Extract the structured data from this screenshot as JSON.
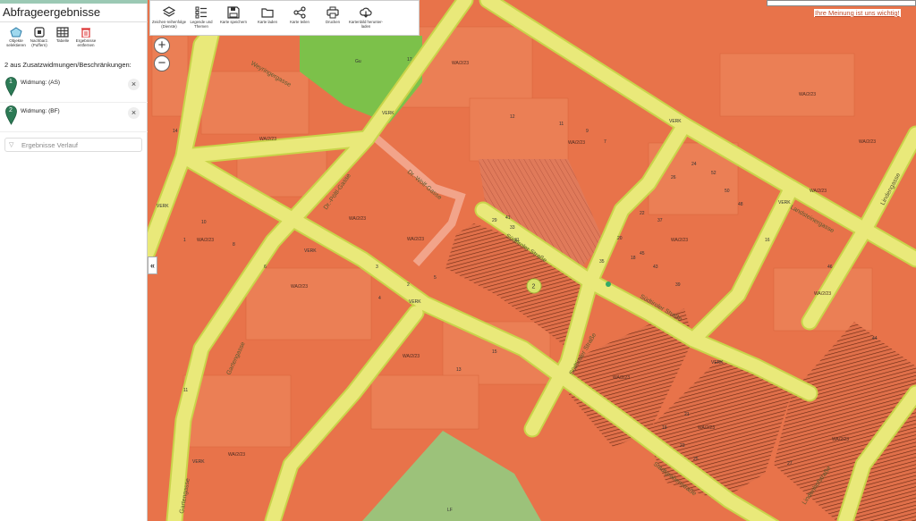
{
  "panel": {
    "title": "Abfrageergebnisse",
    "tools": [
      {
        "icon": "select-objects-icon",
        "label": "Objekte selektieren"
      },
      {
        "icon": "neighbour-search-icon",
        "label": "Nachbarz. (Puffern)"
      },
      {
        "icon": "table-icon",
        "label": "Tabelle"
      },
      {
        "icon": "trash-icon",
        "label": "Ergebnisse entfernen"
      }
    ],
    "count_line": "2 aus Zusatzwidmungen/Beschränkungen:",
    "results": [
      {
        "number": "1",
        "label": "Widmung: (AS)"
      },
      {
        "number": "2",
        "label": "Widmung: (BF)"
      }
    ],
    "remove_symbol": "×",
    "history_placeholder": "Ergebnisse Verlauf",
    "collapse_symbol": "«"
  },
  "toolbar": [
    {
      "icon": "layers-icon",
      "label": "Zeichen-reihenfolge (Dienste)"
    },
    {
      "icon": "legend-icon",
      "label": "Legende und Themen"
    },
    {
      "icon": "save-icon",
      "label": "Karte speichern"
    },
    {
      "icon": "folder-icon",
      "label": "Karte laden"
    },
    {
      "icon": "share-icon",
      "label": "Karte teilen"
    },
    {
      "icon": "print-icon",
      "label": "Drucken"
    },
    {
      "icon": "cloud-download-icon",
      "label": "Kartenbild herunter-laden"
    }
  ],
  "zoom": {
    "in": "+",
    "out": "−"
  },
  "feedback": "Ihre Meinung ist uns wichtig!",
  "map": {
    "colors": {
      "zone": "#e8734a",
      "block": "#ea7d52",
      "road": "#e9e97a",
      "road_edge": "#c9d44a",
      "green": "#7cc14a",
      "park": "#9cc27a",
      "hatch": "#6a2a12"
    },
    "zone_code": "WA/2/23",
    "street_names": [
      "Weyringergasse",
      "Dr.-Pöltl-Gasse",
      "Dr.-Wolf-Gasse",
      "Südtiroler Straße",
      "Südtiroler Straße",
      "Landsteinergasse",
      "Lindengasse",
      "Gartengasse",
      "Gartengasse",
      "Stadtgrabenstraße",
      "Lindenhofstraße"
    ],
    "road_labels": [
      "VERK",
      "VERK",
      "VERK",
      "VERK",
      "VERK",
      "VERK",
      "VERK",
      "VERK"
    ],
    "green_label": "Gu",
    "park_label": "LF",
    "marker_label": "2",
    "parcel_numbers": [
      "14",
      "12",
      "11",
      "9",
      "7",
      "17",
      "10",
      "8",
      "6",
      "1",
      "3",
      "5",
      "15",
      "13",
      "11",
      "26",
      "24",
      "22",
      "20",
      "18",
      "16",
      "21",
      "19",
      "23",
      "25",
      "27",
      "2",
      "4",
      "33",
      "31",
      "29",
      "41",
      "35",
      "37",
      "45",
      "43",
      "39",
      "52",
      "50",
      "48",
      "46",
      "44"
    ]
  }
}
